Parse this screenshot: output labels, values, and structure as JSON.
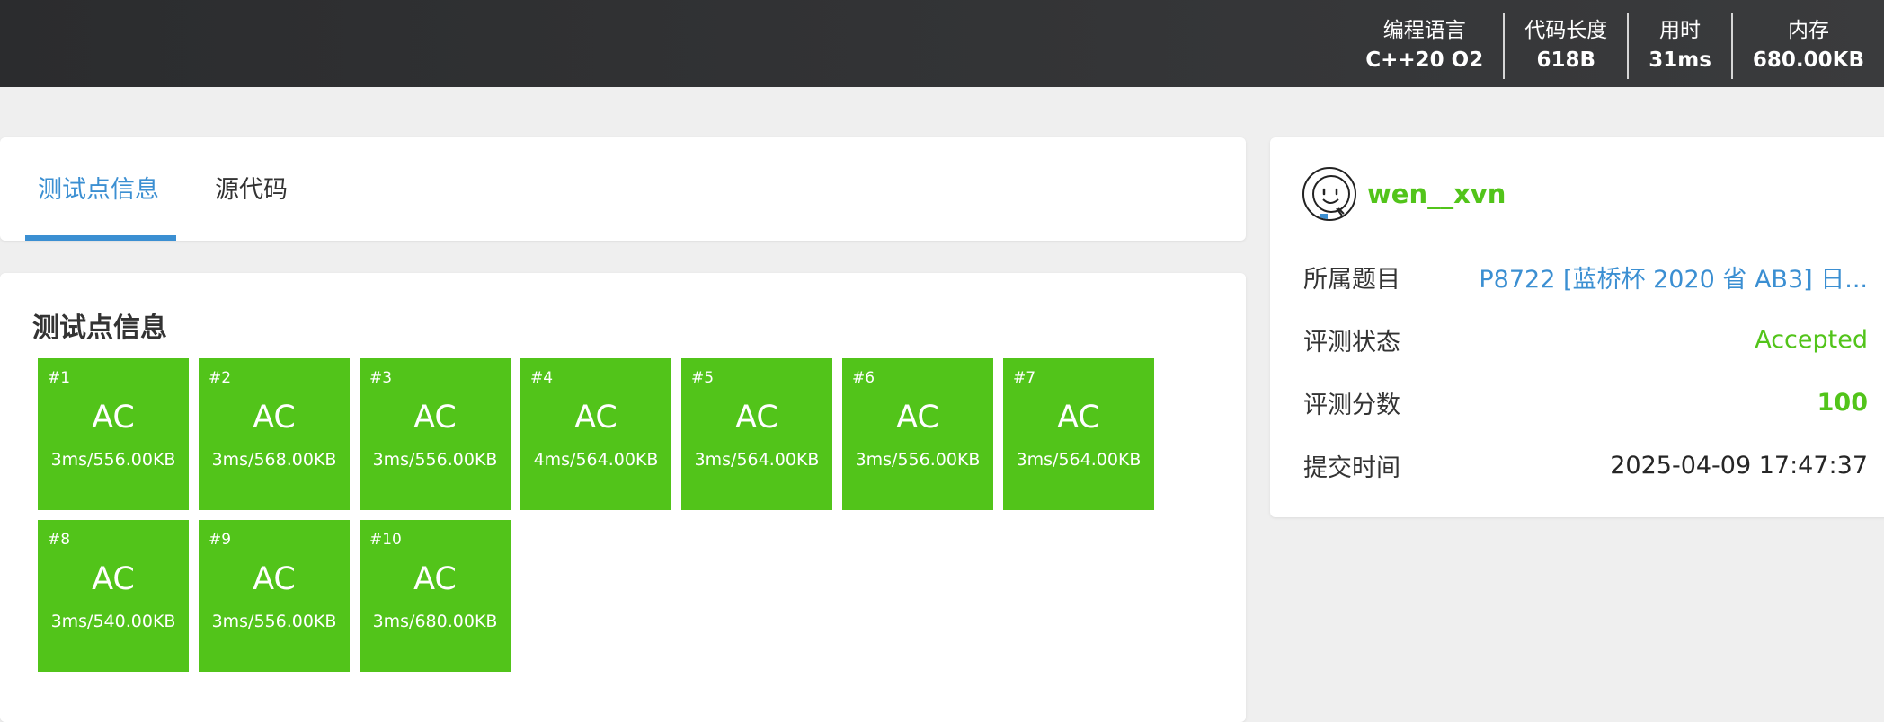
{
  "header": {
    "stats": [
      {
        "label": "编程语言",
        "value": "C++20 O2"
      },
      {
        "label": "代码长度",
        "value": "618B"
      },
      {
        "label": "用时",
        "value": "31ms"
      },
      {
        "label": "内存",
        "value": "680.00KB"
      }
    ]
  },
  "tabs": [
    {
      "label": "测试点信息",
      "active": true
    },
    {
      "label": "源代码",
      "active": false
    }
  ],
  "cases_section": {
    "title": "测试点信息",
    "cases": [
      {
        "id": "#1",
        "status": "AC",
        "info": "3ms/556.00KB"
      },
      {
        "id": "#2",
        "status": "AC",
        "info": "3ms/568.00KB"
      },
      {
        "id": "#3",
        "status": "AC",
        "info": "3ms/556.00KB"
      },
      {
        "id": "#4",
        "status": "AC",
        "info": "4ms/564.00KB"
      },
      {
        "id": "#5",
        "status": "AC",
        "info": "3ms/564.00KB"
      },
      {
        "id": "#6",
        "status": "AC",
        "info": "3ms/556.00KB"
      },
      {
        "id": "#7",
        "status": "AC",
        "info": "3ms/564.00KB"
      },
      {
        "id": "#8",
        "status": "AC",
        "info": "3ms/540.00KB"
      },
      {
        "id": "#9",
        "status": "AC",
        "info": "3ms/556.00KB"
      },
      {
        "id": "#10",
        "status": "AC",
        "info": "3ms/680.00KB"
      }
    ],
    "ac_color": "#52c41a"
  },
  "info": {
    "username": "wen__xvn",
    "avatar_icon": "smiley-face-icon",
    "rows": [
      {
        "label": "所属题目",
        "value": "P8722 [蓝桥杯 2020 省 AB3] 日..."
      },
      {
        "label": "评测状态",
        "value": "Accepted"
      },
      {
        "label": "评测分数",
        "value": "100"
      },
      {
        "label": "提交时间",
        "value": "2025-04-09 17:47:37"
      }
    ]
  },
  "colors": {
    "accent": "#3b8fd2",
    "success": "#52c41a",
    "topbar": "#2b2c2e"
  }
}
